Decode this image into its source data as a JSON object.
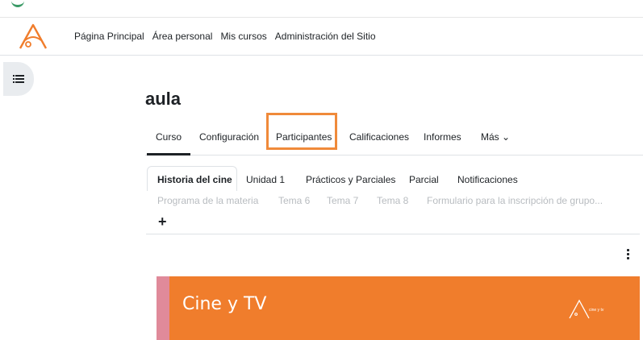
{
  "colors": {
    "accent": "#f07d2c",
    "highlight_box": "#f08a3a",
    "banner_stripe": "#e08a9a",
    "text": "#1d2125",
    "faded_text": "#b8bcc0"
  },
  "navbar": {
    "logo_icon": "aula-logo-icon",
    "items": [
      "Página Principal",
      "Área personal",
      "Mis cursos",
      "Administración del Sitio"
    ]
  },
  "drawer": {
    "icon": "list-icon"
  },
  "page": {
    "title": "aula"
  },
  "course_tabs": {
    "curso": "Curso",
    "configuracion": "Configuración",
    "participantes": "Participantes",
    "calificaciones": "Calificaciones",
    "informes": "Informes",
    "mas": "Más ⌄"
  },
  "section_tabs": {
    "row1": [
      "Historia del cine",
      "Unidad 1",
      "Prácticos y Parciales",
      "Parcial",
      "Notificaciones"
    ],
    "row2": [
      "Programa de la materia",
      "Tema 6",
      "Tema 7",
      "Tema 8",
      "Formulario para la inscripción de grupo..."
    ],
    "add": "+"
  },
  "banner": {
    "title": "Cine y TV",
    "logo_text": "cine y tv"
  }
}
